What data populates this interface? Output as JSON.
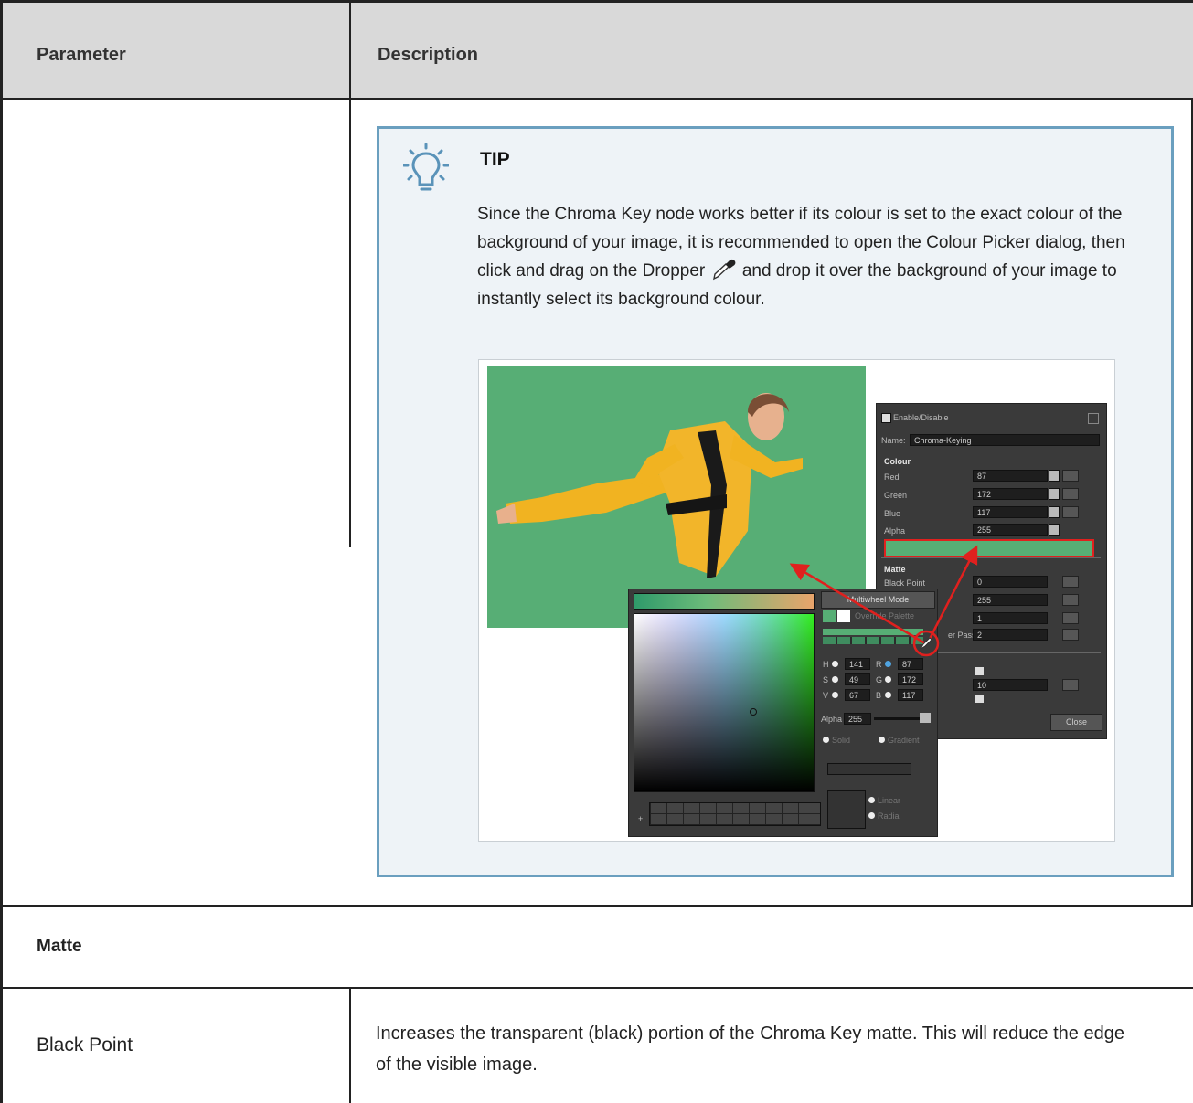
{
  "table": {
    "headers": {
      "parameter": "Parameter",
      "description": "Description"
    },
    "tip": {
      "title": "TIP",
      "text_before_icon": "Since the Chroma Key node works better if its colour is set to the exact colour of the background of your image, it is recommended to open the Colour Picker dialog, then click and drag on the Dropper",
      "text_after_icon": "and drop it over the background of your image to instantly select its background colour.",
      "icons": {
        "tip": "lightbulb-icon",
        "dropper": "dropper-icon"
      }
    },
    "section": {
      "title": "Matte"
    },
    "rows": [
      {
        "parameter": "Black Point",
        "description": "Increases the transparent (black) portion of the Chroma Key matte. This will reduce the edge of the visible image."
      }
    ]
  },
  "screenshot": {
    "layer_panel": {
      "enable_label": "Enable/Disable",
      "name_label": "Name:",
      "name_value": "Chroma-Keying",
      "colour_heading": "Colour",
      "colour_fields": [
        {
          "label": "Red",
          "value": "87"
        },
        {
          "label": "Green",
          "value": "172"
        },
        {
          "label": "Blue",
          "value": "117"
        },
        {
          "label": "Alpha",
          "value": "255"
        }
      ],
      "swatch_color": "#57ae75",
      "matte_heading": "Matte",
      "matte_fields": [
        {
          "label": "Black Point",
          "value": "0"
        },
        {
          "label": "",
          "value": "255"
        },
        {
          "label": "",
          "value": "1"
        },
        {
          "label": "er Pass",
          "value": "2"
        }
      ],
      "extra_value": "10",
      "close_label": "Close"
    },
    "colour_picker": {
      "multiwheel_button": "Multiwheel Mode",
      "override_label": "Override Palette",
      "hsv": [
        {
          "label": "H",
          "value": "141"
        },
        {
          "label": "S",
          "value": "49"
        },
        {
          "label": "V",
          "value": "67"
        }
      ],
      "rgb": [
        {
          "label": "R",
          "value": "87"
        },
        {
          "label": "G",
          "value": "172"
        },
        {
          "label": "B",
          "value": "117"
        }
      ],
      "alpha_label": "Alpha",
      "alpha_value": "255",
      "solid_label": "Solid",
      "gradient_label": "Gradient",
      "linear_label": "Linear",
      "radial_label": "Radial"
    },
    "colors": {
      "chroma_green": "#57ae75",
      "arrow_red": "#e0201e",
      "tip_border": "#6a9fbf"
    }
  }
}
